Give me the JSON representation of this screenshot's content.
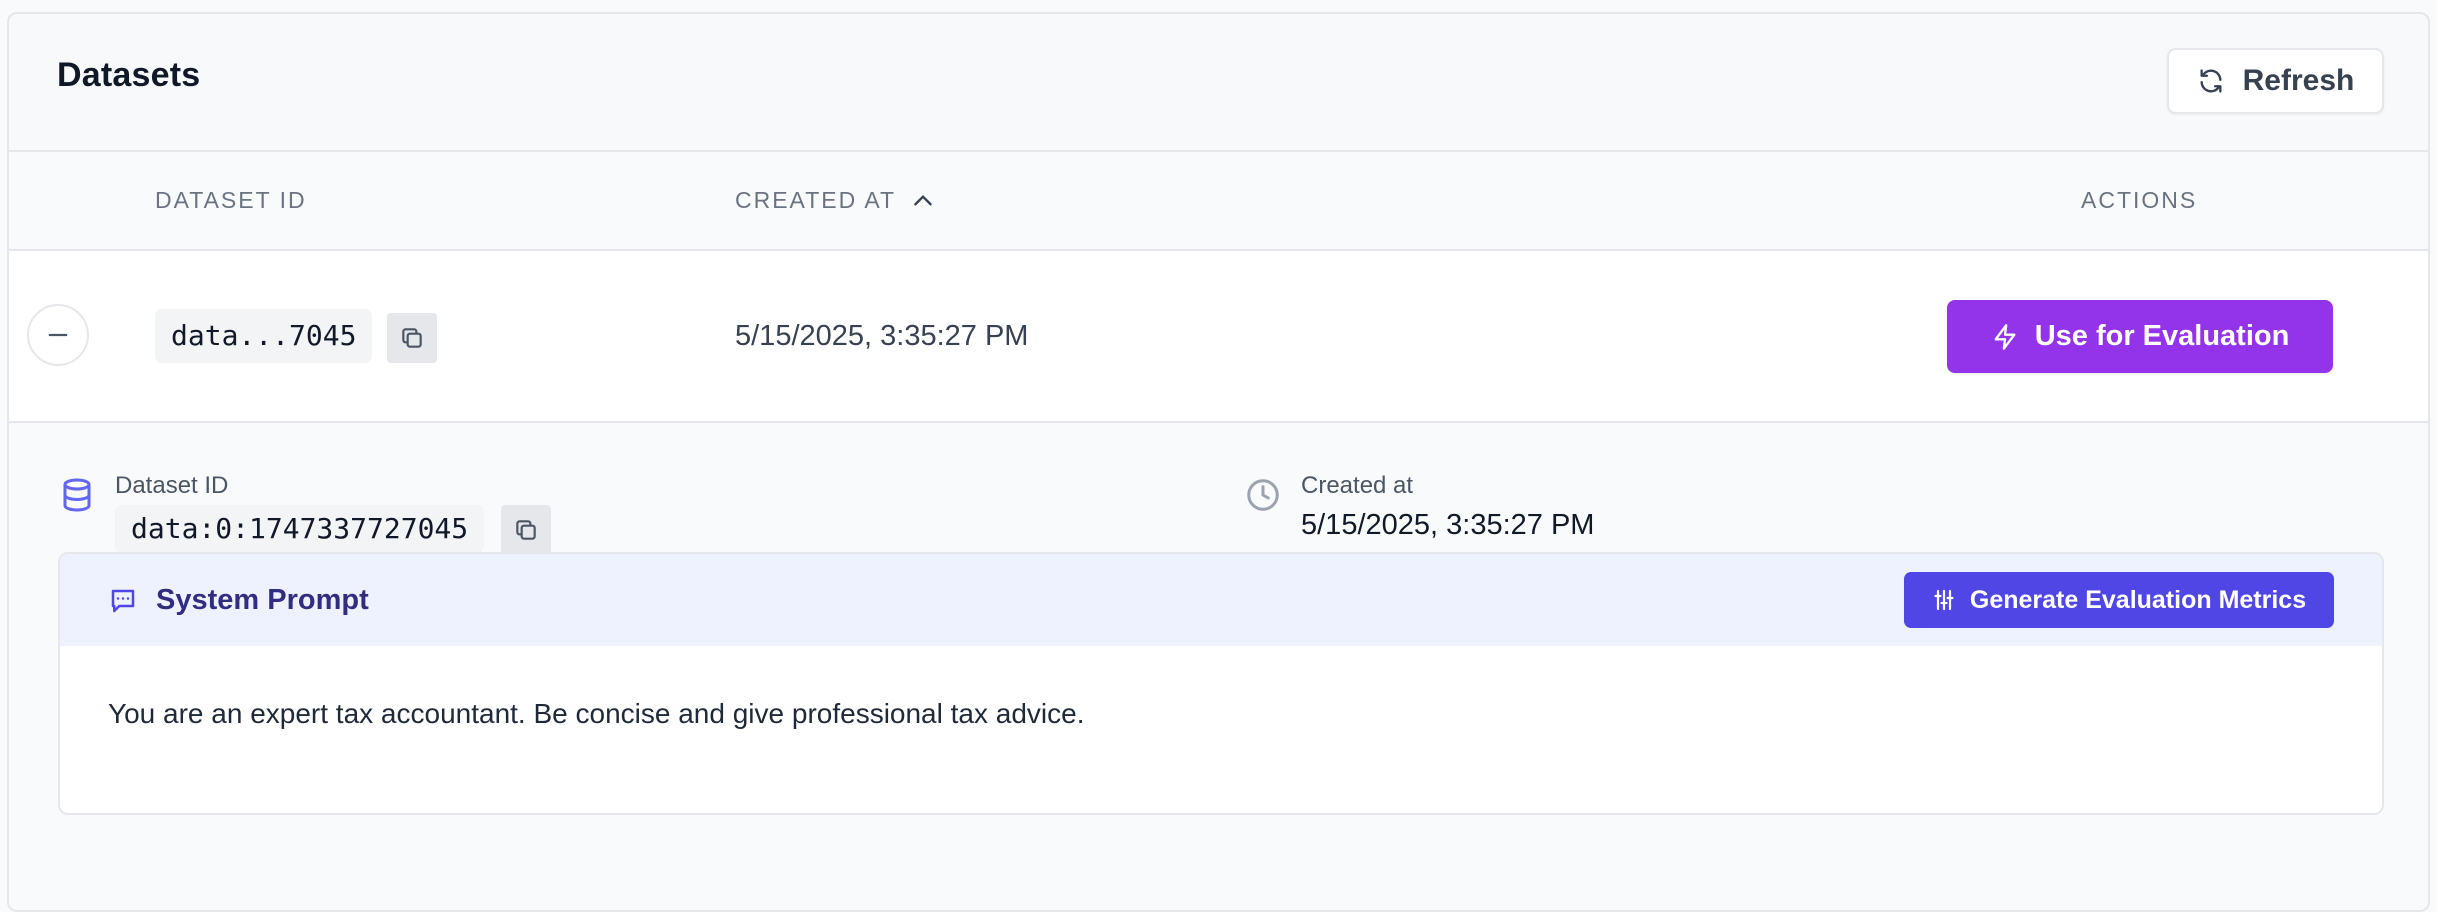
{
  "header": {
    "title": "Datasets",
    "refresh_label": "Refresh"
  },
  "table": {
    "columns": {
      "dataset_id": "Dataset ID",
      "created_at": "Created At",
      "actions": "Actions"
    },
    "sort": {
      "column": "created_at",
      "direction": "ascending"
    },
    "rows": [
      {
        "dataset_id_short": "data...7045",
        "created_at": "5/15/2025, 3:35:27 PM",
        "action_label": "Use for Evaluation",
        "expanded": true
      }
    ]
  },
  "detail": {
    "dataset_id_label": "Dataset ID",
    "dataset_id_full": "data:0:1747337727045",
    "created_label": "Created at",
    "created_value": "5/15/2025, 3:35:27 PM",
    "system_prompt": {
      "title": "System Prompt",
      "generate_label": "Generate Evaluation Metrics",
      "text": "You are an expert tax accountant. Be concise and give professional tax advice."
    }
  },
  "colors": {
    "use_button": "#9333ea",
    "generate_button": "#4f46e5",
    "prompt_header_bg": "#eef2ff",
    "prompt_title": "#312e81",
    "database_icon": "#6366f1"
  },
  "icons": {
    "refresh": "refresh-icon",
    "sort": "chevron-up-icon",
    "collapse": "minus-icon",
    "copy": "copy-icon",
    "use": "lightning-icon",
    "dataset": "database-icon",
    "created": "clock-icon",
    "prompt": "chat-bubble-icon",
    "generate": "sliders-icon"
  }
}
